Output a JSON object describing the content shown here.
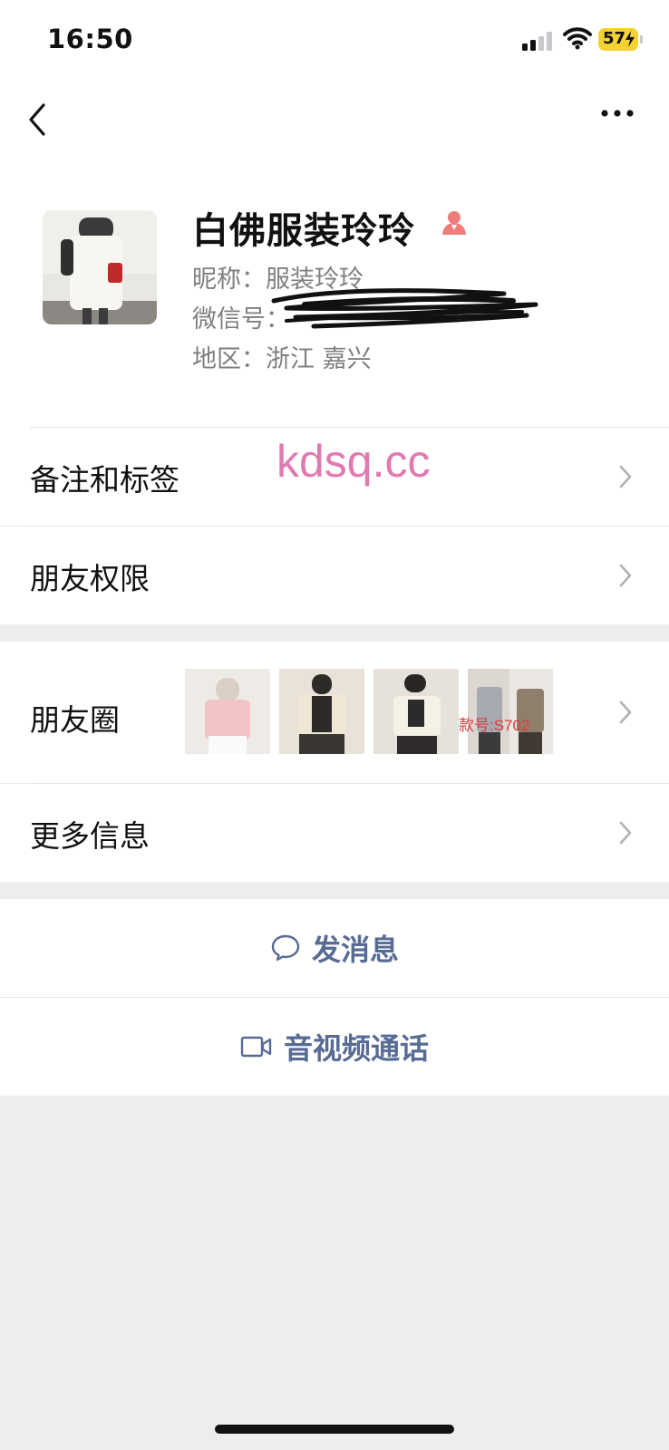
{
  "status_bar": {
    "time": "16:50",
    "battery": "57"
  },
  "nav": {
    "back_icon": "chevron-left-icon",
    "more_icon": "ellipsis-icon"
  },
  "profile": {
    "name": "白佛服装玲玲",
    "nickname": "昵称：服装玲玲",
    "wechat_id_label": "微信号：",
    "region": "地区：浙江 嘉兴",
    "gender_icon": "female-icon"
  },
  "watermark": "kdsq.cc",
  "rows": {
    "remarks": "备注和标签",
    "permissions": "朋友权限",
    "moments": "朋友圈",
    "moments_thumb_text": "款号:S702",
    "more_info": "更多信息"
  },
  "actions": {
    "message": "发消息",
    "call": "音视频通话"
  },
  "colors": {
    "link_blue": "#576b95",
    "gender_pink": "#f07b7b",
    "watermark_pink": "#e07ab0"
  }
}
